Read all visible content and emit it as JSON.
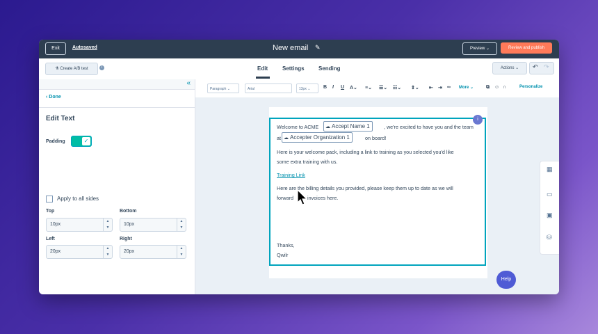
{
  "topbar": {
    "exit_label": "Exit",
    "autosaved_label": "Autosaved",
    "title": "New email",
    "preview_label": "Preview ⌄",
    "publish_label": "Review and publish"
  },
  "tabbar": {
    "abtest_label": "Create A/B test",
    "tabs": [
      {
        "label": "Edit"
      },
      {
        "label": "Settings"
      },
      {
        "label": "Sending"
      }
    ],
    "actions_label": "Actions ⌄"
  },
  "left_panel": {
    "done_label": "Done",
    "title": "Edit Text",
    "padding_label": "Padding",
    "apply_all_label": "Apply to all sides",
    "fields": [
      {
        "label": "Top",
        "value": "10px"
      },
      {
        "label": "Bottom",
        "value": "10px"
      },
      {
        "label": "Left",
        "value": "20px"
      },
      {
        "label": "Right",
        "value": "20px"
      }
    ]
  },
  "toolbar": {
    "paragraph_select": "Paragraph",
    "font_select": "Arial",
    "size_select": "13px",
    "more_label": "More ⌄",
    "personalize_label": "Personalize"
  },
  "email": {
    "line1_pre": "Welcome to ACME",
    "token1": "Accept Name 1",
    "line1_post": ", we're excited to have you and the team",
    "line2_pre": "at",
    "token2": "Accepter Organization 1",
    "line2_post": "on board!",
    "para2_line1": "Here is your welcome pack, including a link to training as you selected you'd like",
    "para2_line2": "some extra training with us.",
    "link_text": "Training Link",
    "para3_line1": "Here are the billing details you provided, please keep them up to date as we will",
    "para3_line2_pre": "forward",
    "para3_line2_post": "invoices here.",
    "thanks": "Thanks,",
    "signature": "Qwilr",
    "badge": "i"
  },
  "help_label": "Help",
  "colors": {
    "accent": "#00a4bd",
    "publish": "#ff7a59",
    "link": "#0091ae"
  }
}
